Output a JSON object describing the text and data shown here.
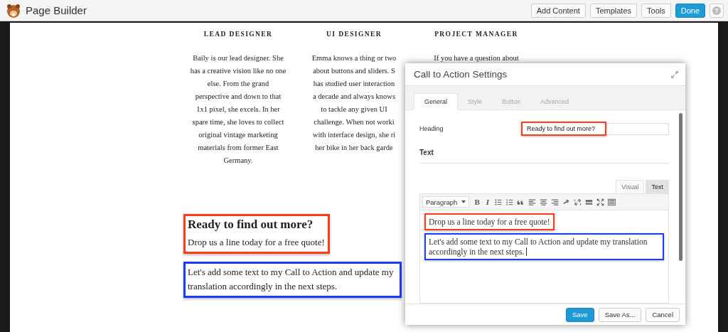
{
  "app_bar": {
    "title": "Page Builder",
    "buttons": [
      {
        "label": "Add Content",
        "kind": "plain"
      },
      {
        "label": "Templates",
        "kind": "plain"
      },
      {
        "label": "Tools",
        "kind": "plain"
      },
      {
        "label": "Done",
        "kind": "primary"
      },
      {
        "label": "?",
        "kind": "help"
      }
    ]
  },
  "team": [
    {
      "role": "LEAD DESIGNER",
      "lines": [
        "Baily is our lead designer. She",
        "has a creative vision like no one",
        "else. From the grand",
        "perspective and down to that",
        "1x1 pixel, she excels. In her",
        "spare time, she loves to collect",
        "original vintage marketing",
        "materials from former East",
        "Germany."
      ]
    },
    {
      "role": "UI DESIGNER",
      "lines": [
        "Emma knows a thing or two",
        "about buttons and sliders. S",
        "has studied user interaction",
        "a decade and always knows",
        "to tackle any given UI",
        "challenge. When not worki",
        "with interface design, she ri",
        "her bike in her back garde"
      ]
    },
    {
      "role": "PROJECT MANAGER",
      "lines": [
        "If you have a question about"
      ]
    }
  ],
  "cta_blocks": [
    {
      "kind": "heading_text",
      "heading": "Ready to find out more?",
      "text": "Drop us a line today for a free quote!",
      "color": "#ff3b1a"
    },
    {
      "kind": "text",
      "text": "Let's add some text to my Call to Action and update my translation accordingly in the next steps.",
      "color": "#1a3bff"
    }
  ],
  "dialog": {
    "title": "Call to Action Settings",
    "tabs": [
      {
        "label": "General",
        "selected": true
      },
      {
        "label": "Style",
        "selected": false
      },
      {
        "label": "Button",
        "selected": false
      },
      {
        "label": "Advanced",
        "selected": false
      }
    ],
    "heading_field": {
      "label": "Heading",
      "value": "Ready to find out more?",
      "color": "#ff3b1a"
    },
    "section": "Text",
    "editor_tabs": [
      {
        "label": "Visual",
        "selected": false
      },
      {
        "label": "Text",
        "selected": true
      }
    ],
    "toolbar": {
      "format": "Paragraph",
      "bold": "B",
      "italic": "I"
    },
    "paragraphs": [
      {
        "text": "Drop us a line today for a free quote!",
        "color": "#ff3b1a",
        "cursor": false
      },
      {
        "text": "Let's add some text to my Call to Action and update my translation accordingly in the next steps.",
        "color": "#1a3bff",
        "cursor": true
      }
    ],
    "buttons": [
      {
        "label": "Save",
        "kind": "primary"
      },
      {
        "label": "Save As...",
        "kind": "plain"
      },
      {
        "label": "Cancel",
        "kind": "plain"
      }
    ]
  }
}
